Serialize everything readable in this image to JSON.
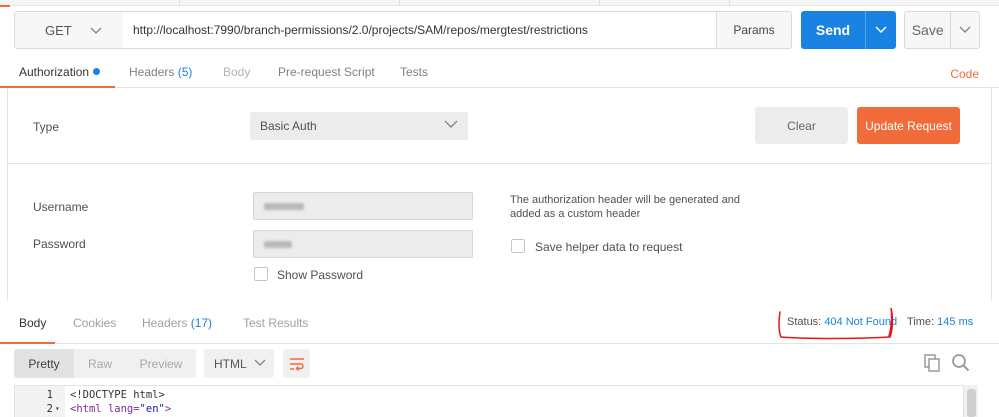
{
  "request": {
    "method": "GET",
    "url": "http://localhost:7990/branch-permissions/2.0/projects/SAM/repos/mergtest/restrictions",
    "params_label": "Params",
    "send_label": "Send",
    "save_label": "Save"
  },
  "request_tabs": {
    "authorization": "Authorization",
    "headers": "Headers",
    "headers_count": "(5)",
    "body": "Body",
    "prerequest": "Pre-request Script",
    "tests": "Tests",
    "code": "Code"
  },
  "auth": {
    "type_label": "Type",
    "type_value": "Basic Auth",
    "clear_label": "Clear",
    "update_label": "Update Request",
    "username_label": "Username",
    "password_label": "Password",
    "show_password_label": "Show Password",
    "note": "The authorization header will be generated and added as a custom header",
    "helper_label": "Save helper data to request"
  },
  "response_tabs": {
    "body": "Body",
    "cookies": "Cookies",
    "headers": "Headers",
    "headers_count": "(17)",
    "test_results": "Test Results"
  },
  "response": {
    "status_label": "Status:",
    "status_value": "404 Not Found",
    "time_label": "Time:",
    "time_value": "145 ms"
  },
  "body_toolbar": {
    "pretty": "Pretty",
    "raw": "Raw",
    "preview": "Preview",
    "language": "HTML"
  },
  "code": {
    "line1_num": "1",
    "line1_text": "<!DOCTYPE html>",
    "line2_num": "2",
    "line2_tag_open": "<html ",
    "line2_attr": "lang=",
    "line2_str": "\"en\"",
    "line2_tag_close": ">"
  },
  "colors": {
    "accent_orange": "#f26b3a",
    "accent_blue": "#1a82e2",
    "annotation_red": "#e8141a"
  }
}
